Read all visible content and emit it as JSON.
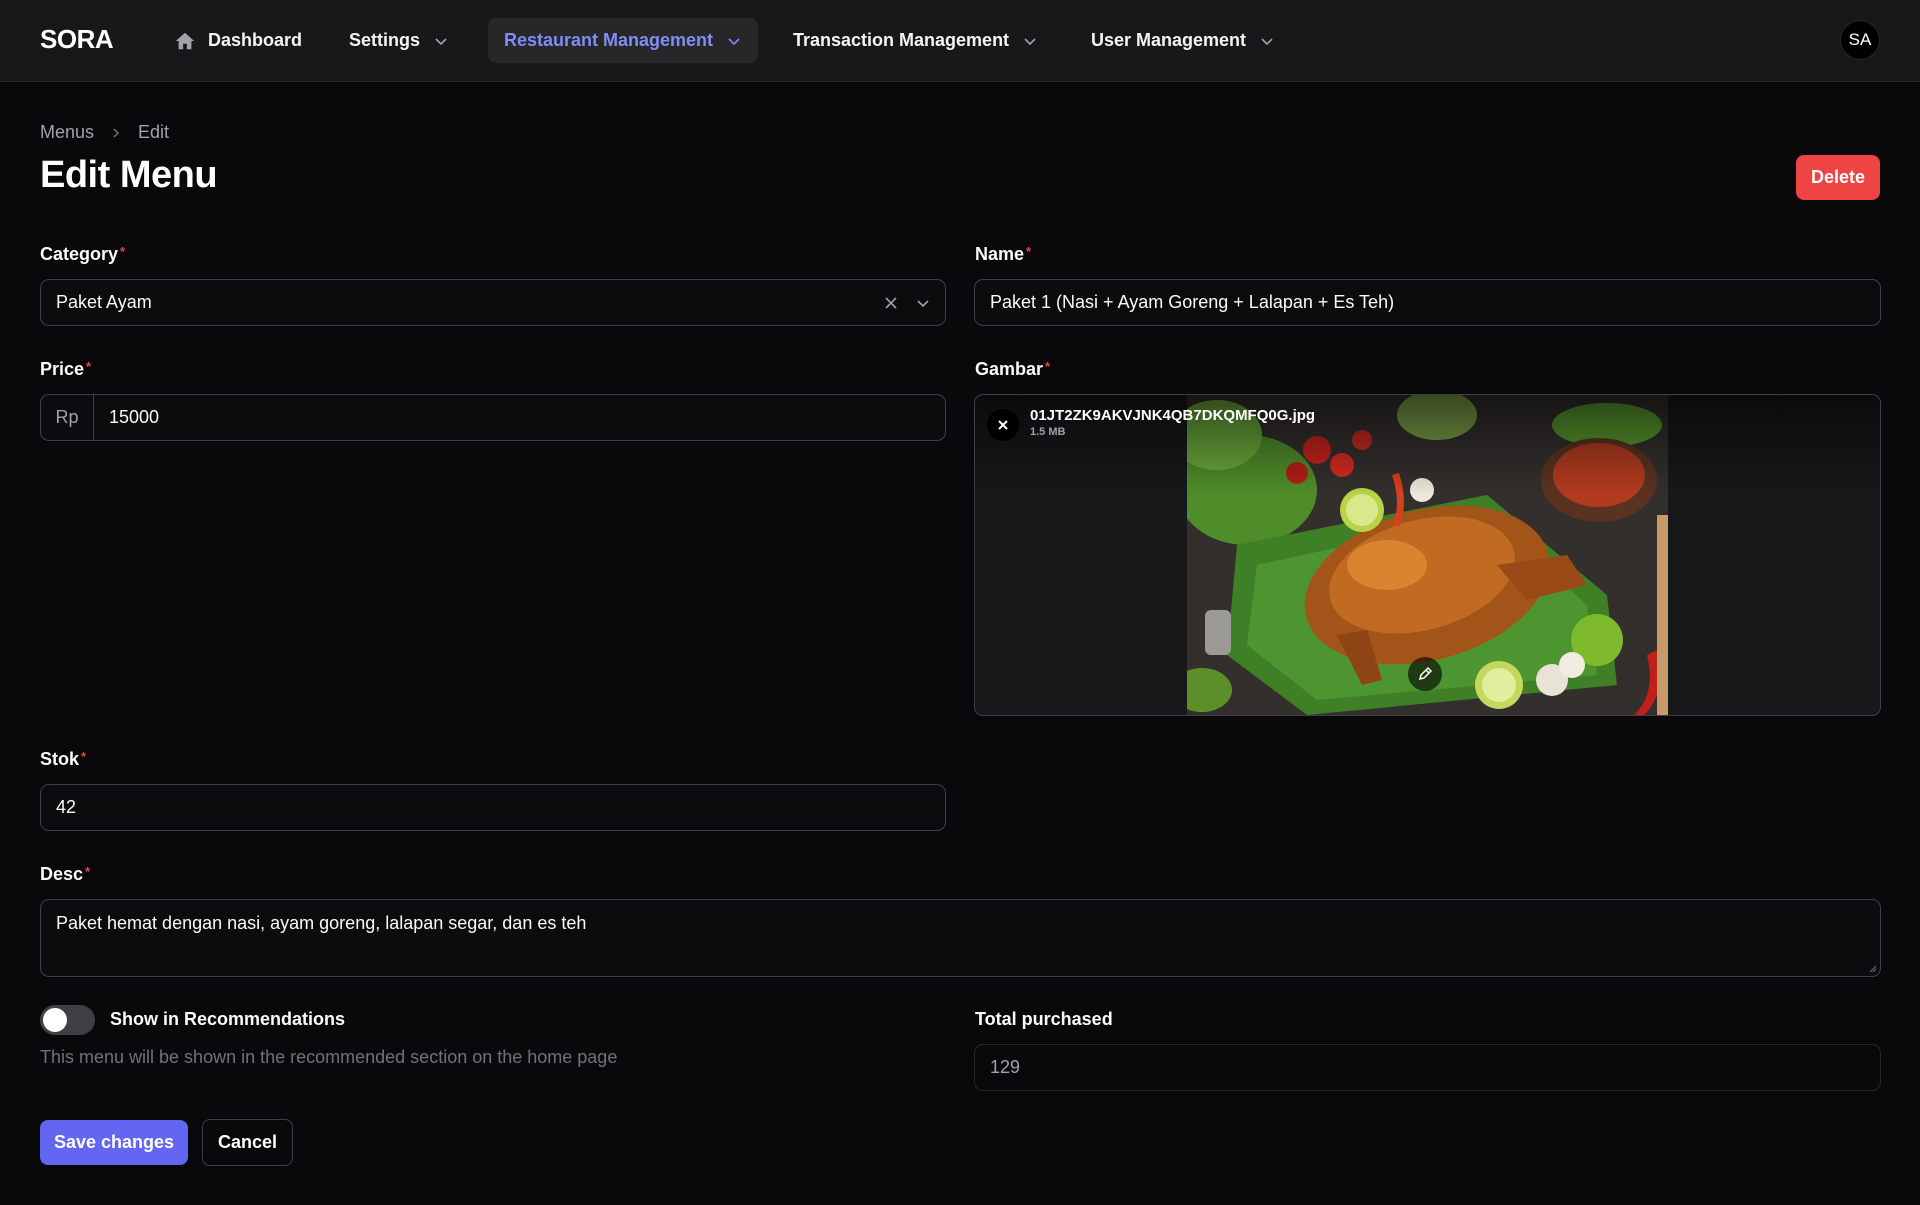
{
  "nav": {
    "brand": "SORA",
    "items": [
      {
        "label": "Dashboard",
        "icon": "home-icon"
      },
      {
        "label": "Settings"
      },
      {
        "label": "Restaurant Management",
        "active": true
      },
      {
        "label": "Transaction Management"
      },
      {
        "label": "User Management"
      }
    ],
    "avatar": "SA"
  },
  "breadcrumb": {
    "parent": "Menus",
    "current": "Edit"
  },
  "page": {
    "title": "Edit Menu",
    "delete_label": "Delete"
  },
  "form": {
    "category": {
      "label": "Category",
      "value": "Paket Ayam"
    },
    "name": {
      "label": "Name",
      "value": "Paket 1 (Nasi + Ayam Goreng + Lalapan + Es Teh)"
    },
    "price": {
      "label": "Price",
      "prefix": "Rp",
      "value": "15000"
    },
    "gambar": {
      "label": "Gambar",
      "file_name": "01JT2ZK9AKVJNK4QB7DKQMFQ0G.jpg",
      "file_size": "1.5 MB"
    },
    "stok": {
      "label": "Stok",
      "value": "42"
    },
    "desc": {
      "label": "Desc",
      "value": "Paket hemat dengan nasi, ayam goreng, lalapan segar, dan es teh"
    },
    "recommend": {
      "label": "Show in Recommendations",
      "helper": "This menu will be shown in the recommended section on the home page",
      "on": false
    },
    "total_purchased": {
      "label": "Total purchased",
      "value": "129"
    },
    "required_mark": "*"
  },
  "actions": {
    "save_label": "Save changes",
    "cancel_label": "Cancel"
  },
  "colors": {
    "accent": "#6366f1",
    "danger": "#ef4444",
    "background": "#09090b"
  }
}
